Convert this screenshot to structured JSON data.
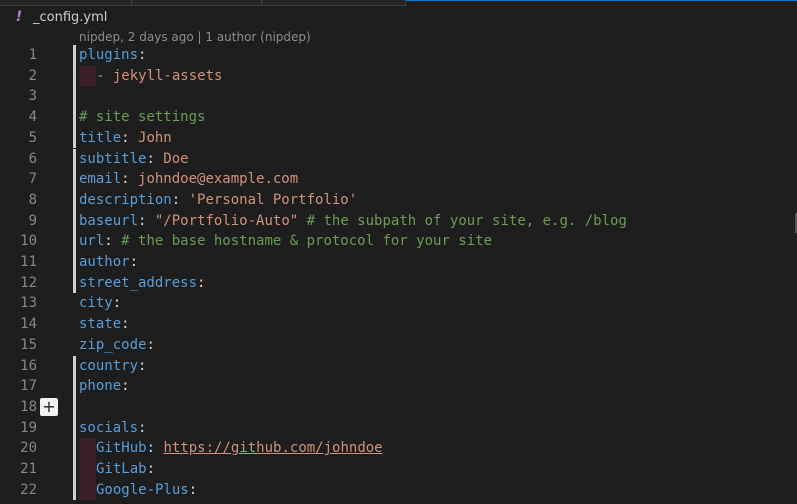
{
  "file": {
    "name": "_config.yml",
    "icon": "yaml-exclamation-icon",
    "icon_glyph": "!"
  },
  "blame": {
    "text": "nipdep, 2 days ago | 1 author (nipdep)"
  },
  "lines": [
    {
      "num": "1",
      "key": "plugins",
      "sep": ":",
      "rest": ""
    },
    {
      "num": "2",
      "indent": true,
      "text": "- jekyll-assets"
    },
    {
      "num": "3",
      "text": ""
    },
    {
      "num": "4",
      "comment": "# site settings"
    },
    {
      "num": "5",
      "key": "title",
      "sep": ":",
      "value": " John"
    },
    {
      "num": "6",
      "key": "subtitle",
      "sep": ":",
      "value": " Doe"
    },
    {
      "num": "7",
      "key": "email",
      "sep": ":",
      "value": " johndoe@example.com"
    },
    {
      "num": "8",
      "key": "description",
      "sep": ":",
      "value": " 'Personal Portfolio'"
    },
    {
      "num": "9",
      "key": "baseurl",
      "sep": ":",
      "value": " \"/Portfolio-Auto\"",
      "comment": " # the subpath of your site, e.g. /blog"
    },
    {
      "num": "10",
      "key": "url",
      "sep": ":",
      "comment": " # the base hostname & protocol for your site"
    },
    {
      "num": "11",
      "key": "author",
      "sep": ":"
    },
    {
      "num": "12",
      "key": "street_address",
      "sep": ":"
    },
    {
      "num": "13",
      "key": "city",
      "sep": ":"
    },
    {
      "num": "14",
      "key": "state",
      "sep": ":"
    },
    {
      "num": "15",
      "key": "zip_code",
      "sep": ":"
    },
    {
      "num": "16",
      "key": "country",
      "sep": ":"
    },
    {
      "num": "17",
      "key": "phone",
      "sep": ":"
    },
    {
      "num": "18",
      "text": ""
    },
    {
      "num": "19",
      "key": "socials",
      "sep": ":"
    },
    {
      "num": "20",
      "indent": true,
      "key": "GitHub",
      "sep": ":",
      "link": "https://github.com/johndoe"
    },
    {
      "num": "21",
      "indent": true,
      "key": "GitLab",
      "sep": ":"
    },
    {
      "num": "22",
      "indent": true,
      "key": "Google-Plus",
      "sep": ":"
    }
  ],
  "gutter": {
    "modified_lines": [
      "1",
      "2",
      "3",
      "4",
      "5",
      "6",
      "7",
      "8",
      "9",
      "10",
      "11",
      "12",
      "16",
      "17",
      "18",
      "19",
      "20",
      "21",
      "22"
    ],
    "add_button_line": "18",
    "add_glyph": "+"
  },
  "colors": {
    "background": "#1e1e1e",
    "key": "#569cd6",
    "string": "#ce9178",
    "comment": "#6a9955",
    "line_number": "#858585"
  }
}
